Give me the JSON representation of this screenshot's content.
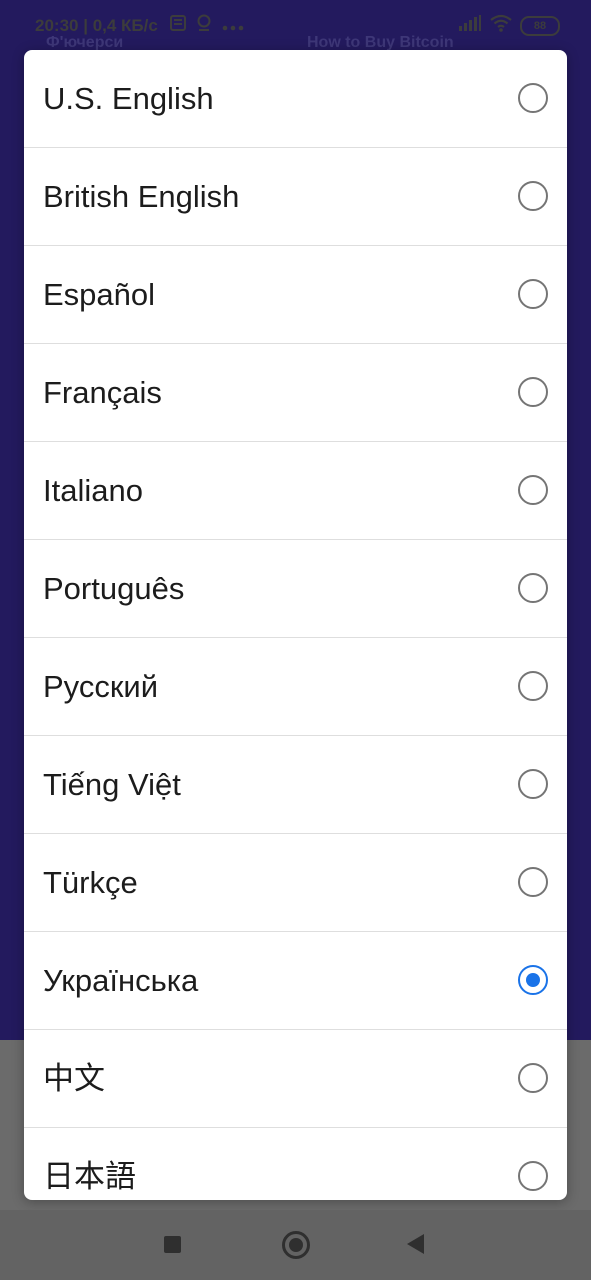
{
  "status_bar": {
    "time": "20:30",
    "speed": "| 0,4 КБ/с",
    "battery": "88"
  },
  "background": {
    "tab_left": "Ф'ючерси",
    "tab_right": "How to Buy Bitcoin"
  },
  "dialog": {
    "items": [
      {
        "label": "U.S. English",
        "selected": false
      },
      {
        "label": "British English",
        "selected": false
      },
      {
        "label": "Español",
        "selected": false
      },
      {
        "label": "Français",
        "selected": false
      },
      {
        "label": "Italiano",
        "selected": false
      },
      {
        "label": "Português",
        "selected": false
      },
      {
        "label": "Русский",
        "selected": false
      },
      {
        "label": "Tiếng Việt",
        "selected": false
      },
      {
        "label": "Türkçe",
        "selected": false
      },
      {
        "label": "Українська",
        "selected": true
      },
      {
        "label": "中文",
        "selected": false
      },
      {
        "label": "日本語",
        "selected": false
      }
    ]
  },
  "colors": {
    "accent": "#1a73e8",
    "background_app": "#231a5e"
  },
  "icons": {
    "status_left": [
      "notes-icon",
      "location-icon",
      "more-icon"
    ],
    "status_right": [
      "signal-icon",
      "wifi-icon",
      "battery-icon"
    ],
    "nav": [
      "recent-apps-icon",
      "home-icon",
      "back-icon"
    ]
  }
}
